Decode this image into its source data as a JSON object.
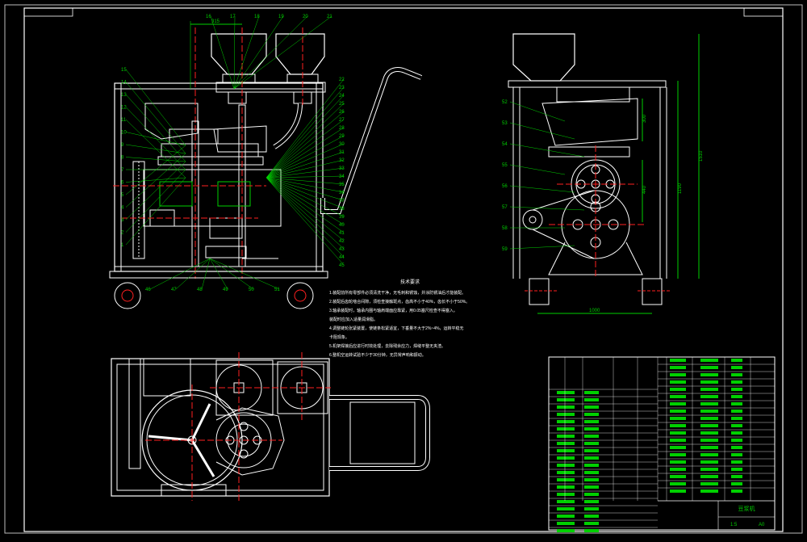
{
  "drawing": {
    "background": "#000000",
    "frame_color": "#ffffff",
    "line_color": "#ffffff",
    "center_line_color": "#ff2020",
    "dimension_color": "#00d000",
    "leader_color": "#00d000",
    "part_color": "#ffffff"
  },
  "balloons_front": [
    "15",
    "14",
    "13",
    "12",
    "11",
    "10",
    "9",
    "8",
    "7",
    "6",
    "5",
    "4",
    "3",
    "2",
    "1",
    "16",
    "17",
    "18",
    "19",
    "20",
    "21",
    "22",
    "23",
    "24",
    "25",
    "26",
    "27",
    "28",
    "29",
    "30",
    "31",
    "32",
    "33",
    "34",
    "35",
    "36",
    "37",
    "38",
    "39",
    "40",
    "41",
    "42",
    "43",
    "44",
    "45",
    "46",
    "47",
    "48",
    "49",
    "50",
    "51"
  ],
  "balloons_side": [
    "52",
    "53",
    "54",
    "55",
    "56",
    "57",
    "58",
    "59"
  ],
  "dims_front": {
    "top_width": "315"
  },
  "dims_side": {
    "overall_height": "1510",
    "body_height": "1190",
    "base_width": "1000",
    "h1": "440",
    "h2": "300"
  },
  "notes": {
    "title": "技术要求",
    "lines": [
      "1.装配前所有零部件必须清洗干净，无毛刺和锈蚀，并涂防锈油后才能装配。",
      "2.装配后齿轮啮合间隙，须检查接触斑点，齿高不小于40%，齿长不小于50%。",
      "3.轴承装配时，轴承内圈与轴肩端面应靠紧，用0.05塞尺检查不得塞入。",
      "  装配时应加入适量润滑脂。",
      "4.调整链轮张紧装置，使链条松紧适宜，下垂量不大于2%~4%，运转平稳无",
      "  卡阻现象。",
      "5.机架焊接后应进行时效处理，去除残余应力，焊缝平整无夹渣。",
      "6.整机空运转试验不少于30分钟，无异常声响和振动。"
    ]
  },
  "title_block": {
    "drawing_name": "豆浆机",
    "scale": "1:5",
    "sheet": "A0",
    "rows": 18
  }
}
